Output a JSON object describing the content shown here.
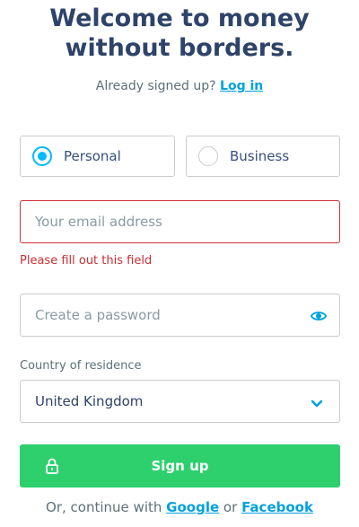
{
  "header": {
    "title_line1": "Welcome to money",
    "title_line2": "without borders.",
    "signed_text": "Already signed up?",
    "login_link": "Log in"
  },
  "account_type": {
    "personal_label": "Personal",
    "business_label": "Business",
    "selected": "Personal"
  },
  "email": {
    "placeholder": "Your email address",
    "value": "",
    "error": "Please fill out this field"
  },
  "password": {
    "placeholder": "Create a password",
    "value": ""
  },
  "country": {
    "label": "Country of residence",
    "value": "United Kingdom"
  },
  "signup": {
    "button_label": "Sign up"
  },
  "social": {
    "prefix": "Or, continue with",
    "google": "Google",
    "or": "or",
    "facebook": "Facebook"
  },
  "colors": {
    "primary_text": "#2e4369",
    "link": "#00a2dd",
    "error": "#c62f35",
    "button": "#2ed06e"
  },
  "icons": [
    "radio-checked",
    "radio-unchecked",
    "eye-icon",
    "chevron-down-icon",
    "lock-icon"
  ]
}
